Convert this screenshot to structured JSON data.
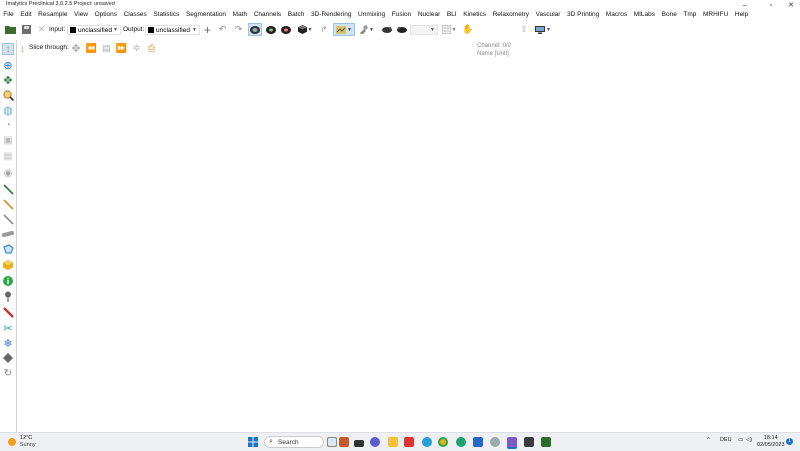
{
  "window": {
    "title": "Imalytics Preclinical 3.0.2.5 Project: unsaved"
  },
  "menu": [
    "File",
    "Edit",
    "Resample",
    "View",
    "Options",
    "Classes",
    "Statistics",
    "Segmentation",
    "Math",
    "Channels",
    "Batch",
    "3D-Rendering",
    "Unmixing",
    "Fusion",
    "Nuclear",
    "BLI",
    "Kinetics",
    "Relaxometry",
    "Vascular",
    "3D Printing",
    "Macros",
    "MILabs",
    "Bone",
    "Tmp",
    "MRHIFU",
    "Help"
  ],
  "toolbar": {
    "input_label": "Input:",
    "input_value": "unclassified",
    "output_label": "Output:",
    "output_value": "unclassified",
    "channel_line1": "Channel: 0/0",
    "channel_line2": "Name [Unit]"
  },
  "slice": {
    "label": "Slice through:"
  },
  "taskbar": {
    "temperature": "12°C",
    "condition": "Sunny",
    "search_label": "Search",
    "language": "DEU",
    "time": "18:14",
    "date": "02/05/2023",
    "notification_count": "1"
  },
  "colors": {
    "accent": "#1a73c8",
    "toolbar_bg": "#ffffff",
    "taskbar_bg": "#eef0f4"
  }
}
